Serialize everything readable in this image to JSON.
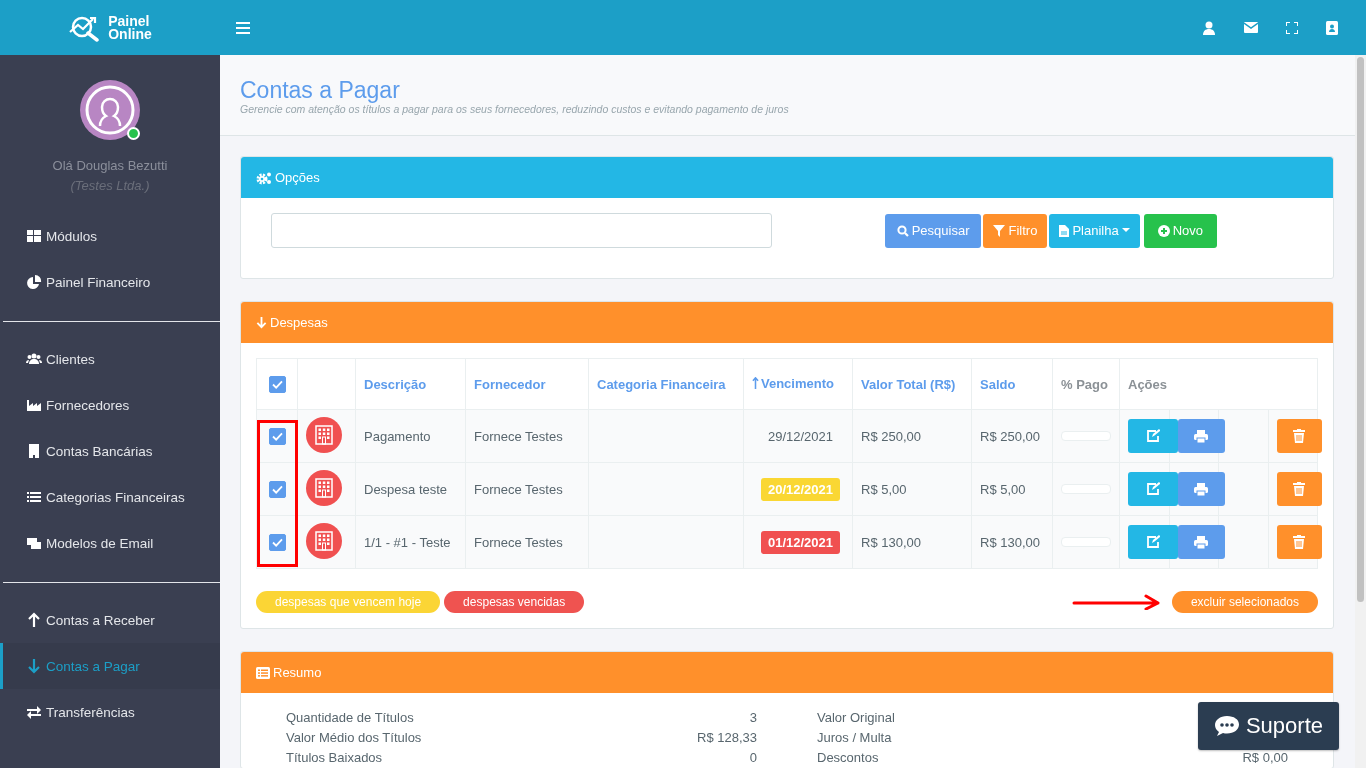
{
  "brand": {
    "line_1": "Painel",
    "line_2": "Online"
  },
  "user": {
    "greeting": "Olá Douglas Bezutti",
    "company": "(Testes Ltda.)",
    "online": true
  },
  "sidebar": {
    "groups": [
      {
        "items": [
          {
            "label": "Módulos",
            "selected": false
          },
          {
            "label": "Painel Financeiro",
            "selected": false
          }
        ]
      },
      {
        "items": [
          {
            "label": "Clientes",
            "selected": false
          },
          {
            "label": "Fornecedores",
            "selected": false
          },
          {
            "label": "Contas Bancárias",
            "selected": false
          },
          {
            "label": "Categorias Financeiras",
            "selected": false
          },
          {
            "label": "Modelos de Email",
            "selected": false
          }
        ]
      },
      {
        "items": [
          {
            "label": "Contas a Receber",
            "selected": false
          },
          {
            "label": "Contas a Pagar",
            "selected": true
          },
          {
            "label": "Transferências",
            "selected": false
          }
        ]
      }
    ]
  },
  "page": {
    "title": "Contas a Pagar",
    "subtitle": "Gerencie com atenção os títulos a pagar para os seus fornecedores, reduzindo custos e evitando pagamento de juros"
  },
  "options": {
    "title": "Opções",
    "buttons": [
      {
        "label": "Pesquisar",
        "kind": "search"
      },
      {
        "label": "Filtro",
        "kind": "filter"
      },
      {
        "label": "Planilha",
        "kind": "sheet"
      },
      {
        "label": "Novo",
        "kind": "new"
      }
    ]
  },
  "expenses": {
    "title": "Despesas",
    "all_checked": true,
    "columns": [
      {
        "label": "Descrição",
        "sortable": true,
        "sorted": false
      },
      {
        "label": "Fornecedor",
        "sortable": true,
        "sorted": false
      },
      {
        "label": "Categoria Financeira",
        "sortable": true,
        "sorted": false
      },
      {
        "label": "Vencimento",
        "sortable": true,
        "sorted": true
      },
      {
        "label": "Valor Total (R$)",
        "sortable": true,
        "sorted": false
      },
      {
        "label": "Saldo",
        "sortable": true,
        "sorted": false
      },
      {
        "label": "% Pago",
        "sortable": false,
        "sorted": false
      },
      {
        "label": "Ações",
        "sortable": false,
        "sorted": false
      }
    ],
    "rows": [
      {
        "checked": true,
        "description": "Pagamento",
        "supplier": "Fornece Testes",
        "due": "29/12/2021",
        "kind": "normal",
        "total": "R$ 250,00",
        "balance": "R$ 250,00",
        "level": 0
      },
      {
        "checked": true,
        "description": "Despesa teste",
        "supplier": "Fornece Testes",
        "due": "20/12/2021",
        "kind": "today",
        "total": "R$ 5,00",
        "balance": "R$ 5,00",
        "level": 0
      },
      {
        "checked": true,
        "description": "1/1 - #1 - Teste",
        "supplier": "Fornece Testes",
        "due": "01/12/2021",
        "kind": "overdue",
        "total": "R$ 130,00",
        "balance": "R$ 130,00",
        "level": 0
      }
    ],
    "legend": [
      {
        "label": "despesas que vencem hoje",
        "color": "#fbd535"
      },
      {
        "label": "despesas vencidas",
        "color": "#ef5350"
      }
    ],
    "delete_selected": "excluir selecionados"
  },
  "summary": {
    "title": "Resumo",
    "left": [
      {
        "label": "Quantidade de Títulos",
        "value": "3"
      },
      {
        "label": "Valor Médio dos Títulos",
        "value": "R$ 128,33"
      },
      {
        "label": "Títulos Baixados",
        "value": "0"
      }
    ],
    "right": [
      {
        "label": "Valor Original"
      },
      {
        "label": "Juros / Multa"
      },
      {
        "label": "Descontos",
        "value": "R$ 0,00"
      }
    ]
  },
  "support": {
    "label": "Suporte"
  }
}
